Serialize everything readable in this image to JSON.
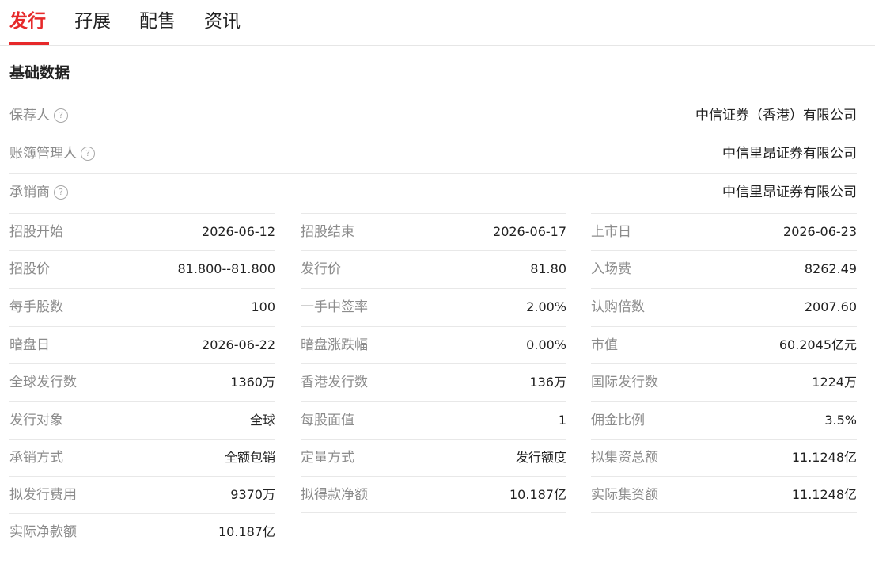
{
  "tabs": [
    "发行",
    "孖展",
    "配售",
    "资讯"
  ],
  "section_title": "基础数据",
  "help_glyph": "?",
  "full_rows": [
    {
      "label": "保荐人",
      "value": "中信证券（香港）有限公司"
    },
    {
      "label": "账簿管理人",
      "value": "中信里昂证券有限公司"
    },
    {
      "label": "承销商",
      "value": "中信里昂证券有限公司"
    }
  ],
  "grid": [
    [
      {
        "label": "招股开始",
        "value": "2026-06-12"
      },
      {
        "label": "招股结束",
        "value": "2026-06-17"
      },
      {
        "label": "上市日",
        "value": "2026-06-23"
      }
    ],
    [
      {
        "label": "招股价",
        "value": "81.800--81.800"
      },
      {
        "label": "发行价",
        "value": "81.80"
      },
      {
        "label": "入场费",
        "value": "8262.49"
      }
    ],
    [
      {
        "label": "每手股数",
        "value": "100"
      },
      {
        "label": "一手中签率",
        "value": "2.00%"
      },
      {
        "label": "认购倍数",
        "value": "2007.60"
      }
    ],
    [
      {
        "label": "暗盘日",
        "value": "2026-06-22"
      },
      {
        "label": "暗盘涨跌幅",
        "value": "0.00%"
      },
      {
        "label": "市值",
        "value": "60.2045亿元"
      }
    ],
    [
      {
        "label": "全球发行数",
        "value": "1360万"
      },
      {
        "label": "香港发行数",
        "value": "136万"
      },
      {
        "label": "国际发行数",
        "value": "1224万"
      }
    ],
    [
      {
        "label": "发行对象",
        "value": "全球"
      },
      {
        "label": "每股面值",
        "value": "1"
      },
      {
        "label": "佣金比例",
        "value": "3.5%"
      }
    ],
    [
      {
        "label": "承销方式",
        "value": "全额包销"
      },
      {
        "label": "定量方式",
        "value": "发行额度"
      },
      {
        "label": "拟集资总额",
        "value": "11.1248亿"
      }
    ],
    [
      {
        "label": "拟发行费用",
        "value": "9370万"
      },
      {
        "label": "拟得款净额",
        "value": "10.187亿"
      },
      {
        "label": "实际集资额",
        "value": "11.1248亿"
      }
    ],
    [
      {
        "label": "实际净款额",
        "value": "10.187亿"
      }
    ]
  ],
  "colors": {
    "accent": "#e6292a",
    "label": "#8c8c8c",
    "value": "#222222",
    "divider": "#e8e8e8"
  }
}
